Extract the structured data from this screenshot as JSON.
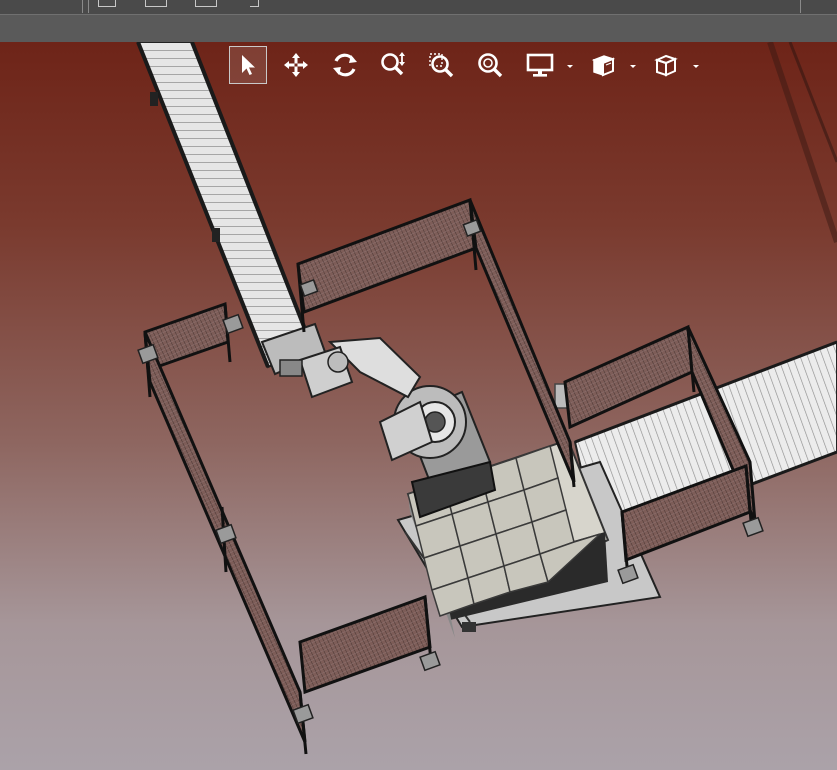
{
  "window": {
    "top_toolbar_icons": [
      "list-icon",
      "layers-icon",
      "printer-icon",
      "arrow-icon"
    ]
  },
  "view_toolbar": {
    "tools": [
      {
        "name": "select-tool",
        "icon": "cursor-icon",
        "active": true
      },
      {
        "name": "pan-tool",
        "icon": "move-arrows-icon",
        "active": false
      },
      {
        "name": "rotate-tool",
        "icon": "rotate-icon",
        "active": false
      },
      {
        "name": "zoom-tool",
        "icon": "zoom-updown-icon",
        "active": false
      },
      {
        "name": "zoom-window-tool",
        "icon": "zoom-window-icon",
        "active": false
      },
      {
        "name": "zoom-fit-tool",
        "icon": "zoom-fit-icon",
        "active": false
      },
      {
        "name": "display-mode-menu",
        "icon": "monitor-icon",
        "has_dropdown": true
      },
      {
        "name": "view-cube-menu",
        "icon": "view-cube-icon",
        "has_dropdown": true
      },
      {
        "name": "projection-menu",
        "icon": "box-outline-icon",
        "has_dropdown": true
      }
    ]
  },
  "viewport": {
    "background_top": "#6e2418",
    "background_bottom": "#aba2a9",
    "scene": "robot-palletizing-cell"
  },
  "colors": {
    "fence_frame": "#111111",
    "fence_mesh": "#7a5a55",
    "conveyor_roller": "#e3e3e3",
    "robot_body": "#d8d8d8",
    "box": "#c8c6bc",
    "pallet": "#2a2a2a"
  }
}
